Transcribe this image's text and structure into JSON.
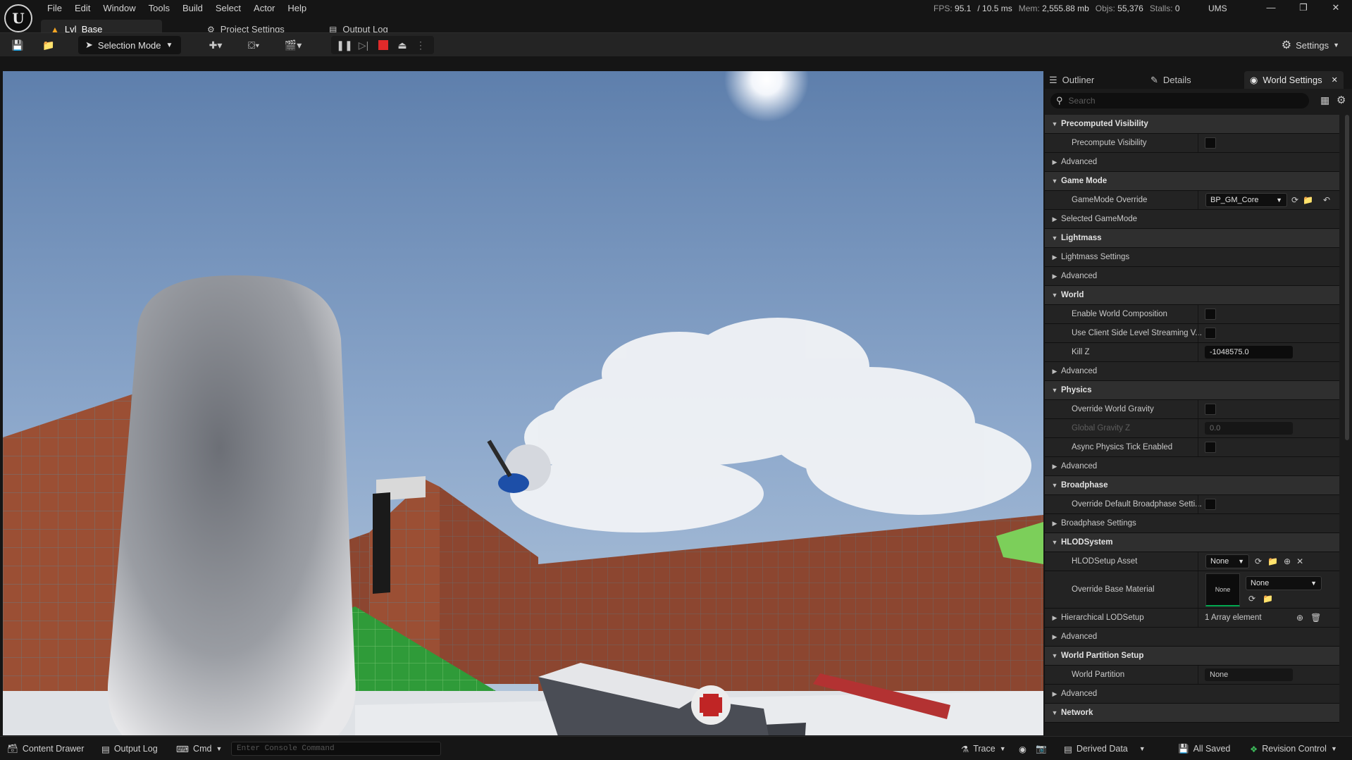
{
  "menu": [
    "File",
    "Edit",
    "Window",
    "Tools",
    "Build",
    "Select",
    "Actor",
    "Help"
  ],
  "stats": {
    "fps_label": "FPS:",
    "fps": "95.1",
    "ms": "/ 10.5 ms",
    "mem_label": "Mem:",
    "mem": "2,555.88 mb",
    "objs_label": "Objs:",
    "objs": "55,376",
    "stalls_label": "Stalls:",
    "stalls": "0"
  },
  "ums": "UMS",
  "tabs": {
    "level": "Lvl_Base",
    "project_settings": "Project Settings",
    "output_log": "Output Log"
  },
  "toolbar": {
    "selection_mode": "Selection Mode",
    "settings": "Settings"
  },
  "panel_tabs": {
    "outliner": "Outliner",
    "details": "Details",
    "world_settings": "World Settings"
  },
  "search": {
    "placeholder": "Search"
  },
  "props": {
    "precomputed_visibility": "Precomputed Visibility",
    "precompute_visibility": "Precompute Visibility",
    "advanced": "Advanced",
    "game_mode": "Game Mode",
    "gamemode_override": "GameMode Override",
    "gamemode_override_value": "BP_GM_Core",
    "selected_gamemode": "Selected GameMode",
    "lightmass": "Lightmass",
    "lightmass_settings": "Lightmass Settings",
    "world": "World",
    "enable_world_composition": "Enable World Composition",
    "use_client_side": "Use Client Side Level Streaming V...",
    "kill_z": "Kill Z",
    "kill_z_value": "-1048575.0",
    "physics": "Physics",
    "override_world_gravity": "Override World Gravity",
    "global_gravity_z": "Global Gravity Z",
    "global_gravity_z_value": "0.0",
    "async_physics": "Async Physics Tick Enabled",
    "broadphase": "Broadphase",
    "override_broadphase": "Override Default Broadphase Setti...",
    "broadphase_settings": "Broadphase Settings",
    "hlod_system": "HLODSystem",
    "hlod_setup_asset": "HLODSetup Asset",
    "hlod_setup_value": "None",
    "override_base_material": "Override Base Material",
    "override_base_material_value": "None",
    "thumb_label": "None",
    "hierarchical_lod_setup": "Hierarchical LODSetup",
    "hierarchical_lod_value": "1 Array element",
    "world_partition_setup": "World Partition Setup",
    "world_partition": "World Partition",
    "world_partition_value": "None",
    "network": "Network"
  },
  "status": {
    "content_drawer": "Content Drawer",
    "output_log": "Output Log",
    "cmd": "Cmd",
    "console_placeholder": "Enter Console Command",
    "trace": "Trace",
    "derived_data": "Derived Data",
    "all_saved": "All Saved",
    "revision_control": "Revision Control"
  }
}
